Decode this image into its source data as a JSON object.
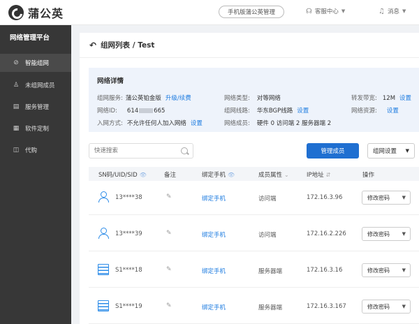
{
  "header": {
    "logo_text": "蒲公英",
    "mobile_button": "手机版蒲公英管理",
    "service_center": "客服中心",
    "messages": "消息"
  },
  "sidebar": {
    "title": "网络管理平台",
    "items": [
      {
        "label": "智能组网",
        "icon": "network-icon",
        "active": true
      },
      {
        "label": "未组网成员",
        "icon": "user-icon",
        "active": false
      },
      {
        "label": "服务管理",
        "icon": "doc-icon",
        "active": false
      },
      {
        "label": "软件定制",
        "icon": "grid-icon",
        "active": false
      },
      {
        "label": "代购",
        "icon": "bookmark-icon",
        "active": false
      }
    ]
  },
  "page": {
    "breadcrumb": "组网列表 / Test"
  },
  "details": {
    "title": "网络详情",
    "service_label": "组网服务:",
    "service_value": "蒲公英铂金版",
    "service_link": "升级/续费",
    "type_label": "网络类型:",
    "type_value": "对等网络",
    "bandwidth_label": "转发带宽:",
    "bandwidth_value": "12M",
    "bandwidth_link": "设置",
    "id_label": "网络ID:",
    "id_prefix": "614",
    "id_suffix": "665",
    "route_label": "组网线路:",
    "route_value": "华东BGP线路",
    "route_link": "设置",
    "resource_label": "网络资源:",
    "resource_link": "设置",
    "join_label": "入网方式:",
    "join_value": "不允许任何人加入网络",
    "join_link": "设置",
    "members_label": "网络成员:",
    "members_value": "硬件 0  访问端 2  服务器端 2"
  },
  "toolbar": {
    "search_placeholder": "快速搜索",
    "manage_members": "管理成员",
    "network_settings": "组网设置"
  },
  "table": {
    "headers": [
      "SN码/UID/SID",
      "备注",
      "绑定手机",
      "成员属性",
      "IP地址",
      "操作"
    ],
    "rows": [
      {
        "type": "user",
        "id": "13****38",
        "bind": "绑定手机",
        "role": "访问端",
        "ip": "172.16.3.96",
        "action": "修改密码"
      },
      {
        "type": "user",
        "id": "13****39",
        "bind": "绑定手机",
        "role": "访问端",
        "ip": "172.16.2.226",
        "action": "修改密码"
      },
      {
        "type": "server",
        "id": "S1****18",
        "bind": "绑定手机",
        "role": "服务器端",
        "ip": "172.16.3.16",
        "action": "修改密码"
      },
      {
        "type": "server",
        "id": "S1****19",
        "bind": "绑定手机",
        "role": "服务器端",
        "ip": "172.16.3.167",
        "action": "修改密码"
      }
    ]
  }
}
